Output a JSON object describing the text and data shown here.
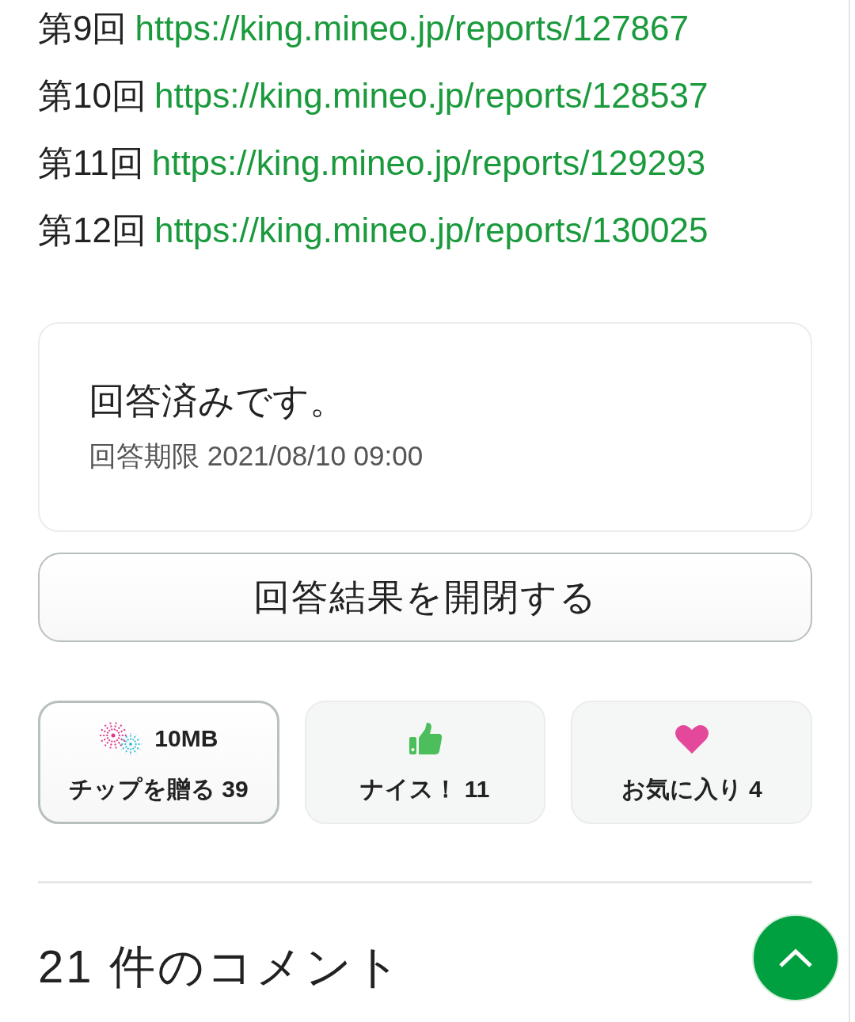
{
  "reports": [
    {
      "label": "第9回",
      "url": "https://king.mineo.jp/reports/127867"
    },
    {
      "label": "第10回",
      "url": "https://king.mineo.jp/reports/128537"
    },
    {
      "label": "第11回",
      "url": "https://king.mineo.jp/reports/129293"
    },
    {
      "label": "第12回",
      "url": "https://king.mineo.jp/reports/130025"
    }
  ],
  "status_card": {
    "title": "回答済みです。",
    "deadline": "回答期限 2021/08/10 09:00"
  },
  "toggle_results_button": "回答結果を開閉する",
  "reactions": [
    {
      "kind": "tip",
      "amount": "10MB",
      "label": "チップを贈る 39"
    },
    {
      "kind": "nice",
      "label": "ナイス！ 11"
    },
    {
      "kind": "favorite",
      "label": "お気に入り 4"
    }
  ],
  "comments_heading": "21 件のコメント"
}
